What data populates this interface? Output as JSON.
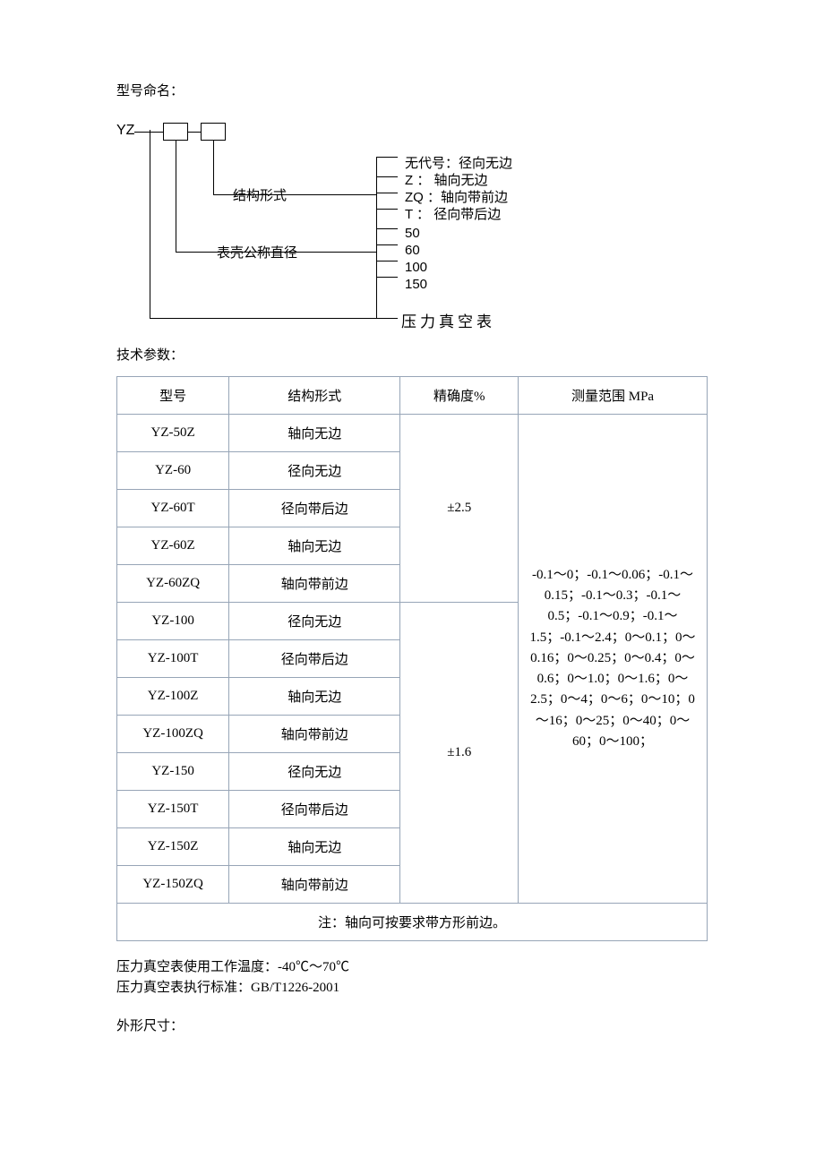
{
  "naming": {
    "heading": "型号命名：",
    "prefix": "YZ",
    "struct_label": "结构形式",
    "diameter_label": "表壳公称直径",
    "struct_options": "无代号：径向无边\nZ ： 轴向无边\nZQ ：轴向带前边\nT ： 径向带后边",
    "diameter_options": "50\n60\n100\n150",
    "bottom_label": "压力真空表"
  },
  "tech": {
    "heading": "技术参数：",
    "headers": {
      "model": "型号",
      "structure": "结构形式",
      "accuracy": "精确度%",
      "range": "测量范围 MPa"
    },
    "rows": [
      {
        "model": "YZ-50Z",
        "structure": "轴向无边"
      },
      {
        "model": "YZ-60",
        "structure": "径向无边"
      },
      {
        "model": "YZ-60T",
        "structure": "径向带后边"
      },
      {
        "model": "YZ-60Z",
        "structure": "轴向无边"
      },
      {
        "model": "YZ-60ZQ",
        "structure": "轴向带前边"
      },
      {
        "model": "YZ-100",
        "structure": "径向无边"
      },
      {
        "model": "YZ-100T",
        "structure": "径向带后边"
      },
      {
        "model": "YZ-100Z",
        "structure": "轴向无边"
      },
      {
        "model": "YZ-100ZQ",
        "structure": "轴向带前边"
      },
      {
        "model": "YZ-150",
        "structure": "径向无边"
      },
      {
        "model": "YZ-150T",
        "structure": "径向带后边"
      },
      {
        "model": "YZ-150Z",
        "structure": "轴向无边"
      },
      {
        "model": "YZ-150ZQ",
        "structure": "轴向带前边"
      }
    ],
    "accuracy_a": "±2.5",
    "accuracy_b": "±1.6",
    "range_text": "-0.1～0；-0.1～0.06；-0.1～0.15；-0.1～0.3；-0.1～0.5；-0.1～0.9；-0.1～1.5；-0.1～2.4；0～0.1；0～0.16；0～0.25；0～0.4；0～0.6；0～1.0；0～1.6；0～2.5；0～4；0～6；0～10；0～16；0～25；0～40；0～60；0～100；",
    "note": "注：轴向可按要求带方形前边。"
  },
  "after": {
    "line1": "压力真空表使用工作温度：-40℃～70℃",
    "line2": "压力真空表执行标准：GB/T1226-2001",
    "dims_heading": "外形尺寸："
  }
}
